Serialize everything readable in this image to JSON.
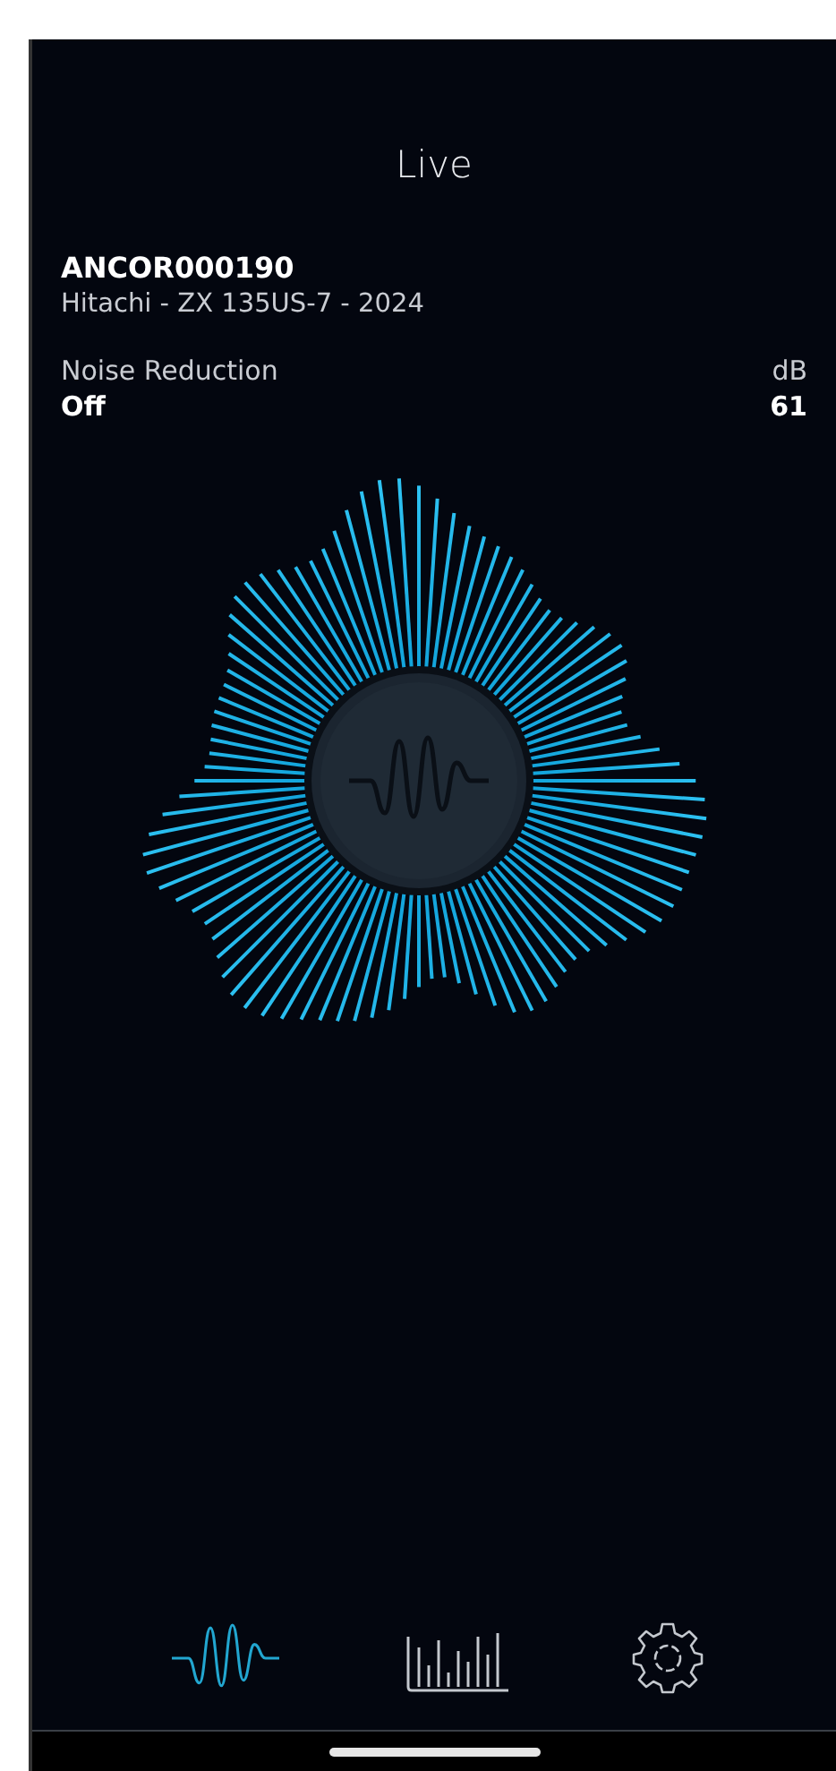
{
  "header": {
    "title": "Live"
  },
  "machine": {
    "id": "ANCOR000190",
    "description": "Hitachi - ZX 135US-7 - 2024"
  },
  "readings": [
    {
      "label": "Noise Reduction",
      "value": "Off"
    },
    {
      "label": "dB",
      "value": "61"
    }
  ],
  "nav": [
    {
      "kind": "wave",
      "selected": true
    },
    {
      "kind": "chart",
      "selected": false
    },
    {
      "kind": "gear",
      "selected": false
    }
  ]
}
